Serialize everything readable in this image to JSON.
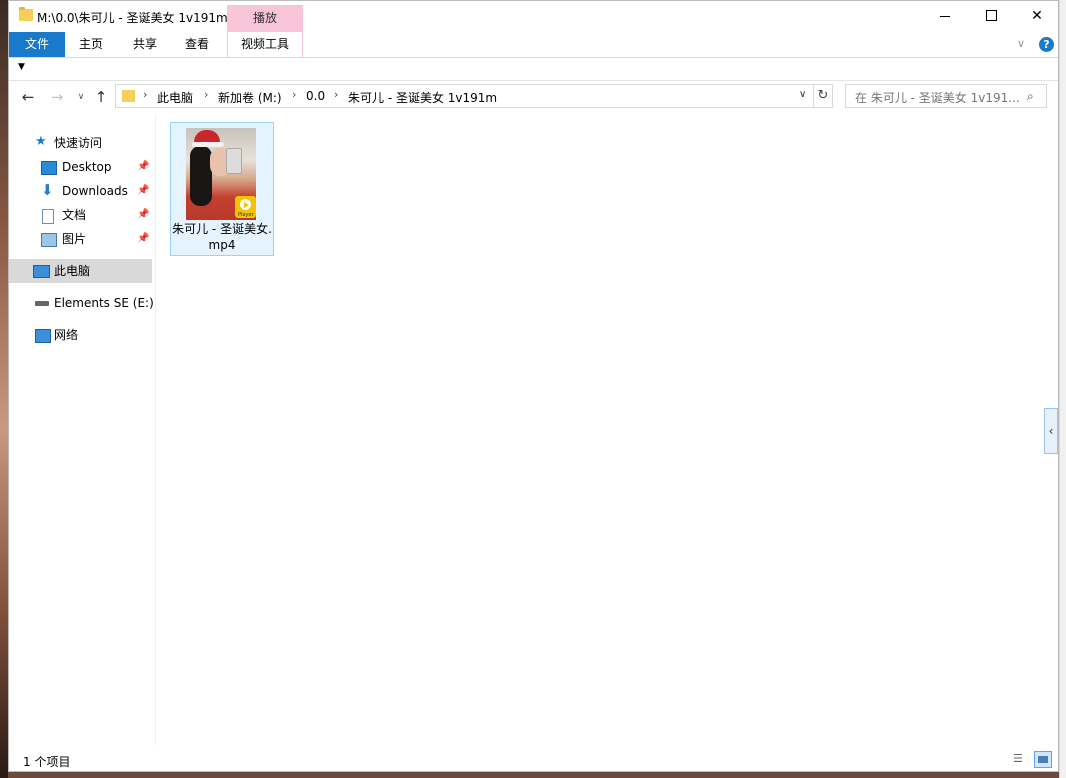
{
  "window": {
    "title": "M:\\0.0\\朱可儿 - 圣诞美女 1v191m",
    "context_tab_header": "播放"
  },
  "ribbon": {
    "tabs": [
      "文件",
      "主页",
      "共享",
      "查看",
      "视频工具"
    ],
    "accent_color": "#1979ca",
    "context_color": "#f9c5d9"
  },
  "address": {
    "breadcrumbs": [
      "此电脑",
      "新加卷 (M:)",
      "0.0",
      "朱可儿 - 圣诞美女 1v191m"
    ],
    "search_placeholder": "在 朱可儿 - 圣诞美女 1v191..."
  },
  "navpane": {
    "quick_access": "快速访问",
    "items": [
      {
        "label": "Desktop",
        "icon": "desktop-icon",
        "pinned": true
      },
      {
        "label": "Downloads",
        "icon": "downloads-icon",
        "pinned": true
      },
      {
        "label": "文档",
        "icon": "documents-icon",
        "pinned": true
      },
      {
        "label": "图片",
        "icon": "pictures-icon",
        "pinned": true
      }
    ],
    "this_pc": "此电脑",
    "drive": "Elements SE (E:)",
    "network": "网络"
  },
  "files": [
    {
      "name": "朱可儿 - 圣诞美女.mp4",
      "badge": "Player"
    }
  ],
  "status": {
    "count": "1 个项目"
  }
}
